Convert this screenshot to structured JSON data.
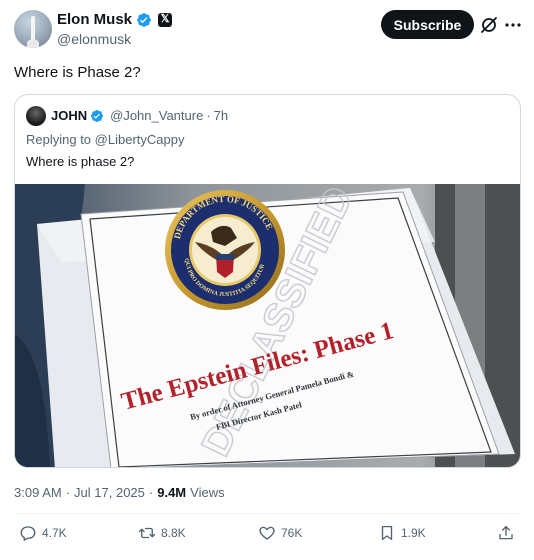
{
  "author": {
    "display_name": "Elon Musk",
    "handle": "@elonmusk",
    "verified_icon": "verified-badge-icon",
    "affiliation_icon": "x-logo-icon",
    "affiliation_letter": "𝕏"
  },
  "header": {
    "subscribe_label": "Subscribe",
    "grok_icon": "grok-icon",
    "more_icon": "more-icon"
  },
  "tweet": {
    "text": "Where is Phase 2?"
  },
  "quote": {
    "display_name": "JOHN",
    "handle": "@John_Vanture",
    "separator": "·",
    "time": "7h",
    "replying_prefix": "Replying to",
    "replying_to": "@LibertyCappy",
    "text": "Where is phase 2?",
    "media": {
      "seal_top_text": "DEPARTMENT OF JUSTICE",
      "seal_bottom_text": "QUI PRO DOMINA JUSTITIA SEQUITUR",
      "stamp_text": "DECLASSIFIED",
      "document_title": "The Epstein Files: Phase 1",
      "document_subtitle_1": "By order of Attorney General Pamela Bondi &",
      "document_subtitle_2": "FBI Director Kash Patel"
    }
  },
  "meta": {
    "time": "3:09 AM",
    "separator": "·",
    "date": "Jul 17, 2025",
    "views_count": "9.4M",
    "views_label": "Views"
  },
  "actions": {
    "replies": "4.7K",
    "reposts": "8.8K",
    "likes": "76K",
    "bookmarks": "1.9K"
  },
  "colors": {
    "accent": "#1d9bf0",
    "text_primary": "#0f1419",
    "text_secondary": "#536471",
    "border": "#cfd9de",
    "doc_title_red": "#b3222b"
  }
}
